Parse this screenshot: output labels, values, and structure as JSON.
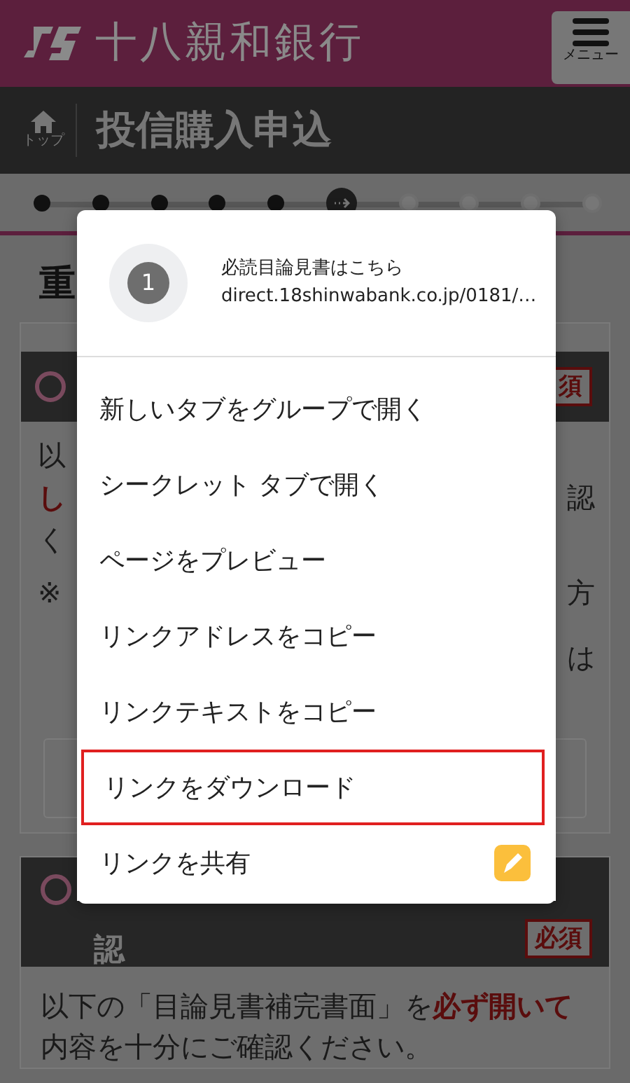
{
  "header": {
    "logo": "十八親和銀行",
    "menu_button": "メニュー"
  },
  "title_bar": {
    "home": "トップ",
    "title": "投信購入申込"
  },
  "steps": [
    {
      "completed": true,
      "current": false
    },
    {
      "completed": true,
      "current": false
    },
    {
      "completed": true,
      "current": false
    },
    {
      "completed": true,
      "current": false
    },
    {
      "completed": true,
      "current": false
    },
    {
      "completed": false,
      "current": true
    },
    {
      "completed": false,
      "current": false
    },
    {
      "completed": false,
      "current": false
    },
    {
      "completed": false,
      "current": false
    },
    {
      "completed": false,
      "current": false
    }
  ],
  "heading": "重",
  "sections": [
    {
      "kind": "partial",
      "badge": "須",
      "left_fragments": [
        {
          "text": "以",
          "emphasis": false
        },
        {
          "text": "し",
          "emphasis": true
        },
        {
          "text": "く",
          "emphasis": false
        },
        {
          "text": "※",
          "emphasis": false
        }
      ],
      "right_fragments": [
        "認",
        "方",
        "は"
      ]
    },
    {
      "kind": "full",
      "title": "認",
      "badge": "必須",
      "body": "以下の「目論見書補完書面」を**必ず開いて**内容を十分にご確認ください。"
    }
  ],
  "context_menu": {
    "favicon": "1",
    "title": "必読目論見書はこちら",
    "url": "direct.18shinwabank.co.jp/0181/…",
    "items": [
      {
        "label": "新しいタブをグループで開く",
        "highlighted": false,
        "kind": "plain"
      },
      {
        "label": "シークレット タブで開く",
        "highlighted": false,
        "kind": "plain"
      },
      {
        "label": "ページをプレビュー",
        "highlighted": false,
        "kind": "plain"
      },
      {
        "label": "リンクアドレスをコピー",
        "highlighted": false,
        "kind": "plain"
      },
      {
        "label": "リンクテキストをコピー",
        "highlighted": false,
        "kind": "plain"
      },
      {
        "label": "リンクをダウンロード",
        "highlighted": true,
        "kind": "plain"
      },
      {
        "label": "リンクを共有",
        "highlighted": false,
        "kind": "share"
      }
    ]
  }
}
